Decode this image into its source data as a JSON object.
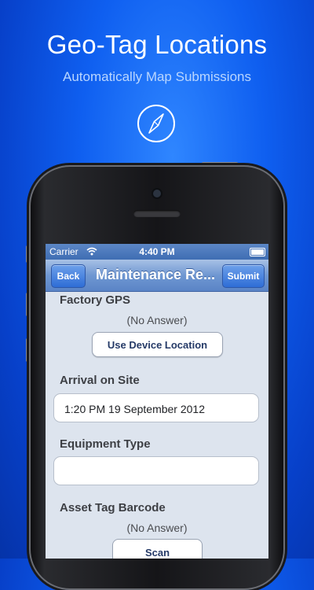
{
  "promo": {
    "headline": "Geo-Tag Locations",
    "subheadline": "Automatically Map Submissions",
    "icon": "compass-icon"
  },
  "status_bar": {
    "carrier": "Carrier",
    "time": "4:40 PM"
  },
  "nav": {
    "back_label": "Back",
    "title": "Maintenance Re...",
    "submit_label": "Submit"
  },
  "form": {
    "factory_gps": {
      "label": "Factory GPS",
      "value": "(No Answer)",
      "button": "Use Device Location"
    },
    "arrival": {
      "label": "Arrival on Site",
      "value": "1:20 PM 19 September 2012"
    },
    "equipment": {
      "label": "Equipment Type",
      "value": ""
    },
    "asset_tag": {
      "label": "Asset Tag Barcode",
      "value": "(No Answer)",
      "button": "Scan"
    }
  },
  "colors": {
    "background": "#0f5ff0",
    "navbar": "#6f97d2",
    "form_background": "#dde4ee"
  }
}
